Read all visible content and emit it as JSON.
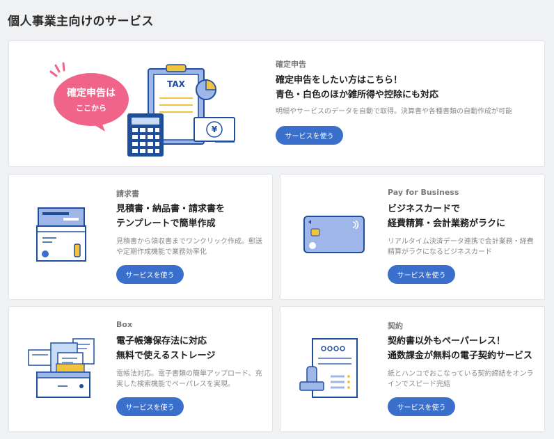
{
  "page": {
    "title": "個人事業主向けのサービス"
  },
  "featured": {
    "category": "確定申告",
    "headline_line1": "確定申告をしたい方はこちら！",
    "headline_line2": "青色・白色のほか雑所得や控除にも対応",
    "description": "明細やサービスのデータを自動で取得。決算書や各種書類の自動作成が可能",
    "button": "サービスを使う",
    "bubble_line1": "確定申告は",
    "bubble_line2": "ここから",
    "tax_label": "TAX",
    "yen_symbol": "¥"
  },
  "cards": [
    {
      "category": "請求書",
      "headline_line1": "見積書・納品書・請求書を",
      "headline_line2": "テンプレートで簡単作成",
      "desc_line1": "見積書から領収書までワンクリック作成。郵送",
      "desc_line2": "や定期作成機能で業務効率化",
      "button": "サービスを使う"
    },
    {
      "category": "Pay for Business",
      "headline_line1": "ビジネスカードで",
      "headline_line2": "経費精算・会計業務がラクに",
      "desc_line1": "リアルタイム決済データ連携で会計業務・経費",
      "desc_line2": "精算がラクになるビジネスカード",
      "button": "サービスを使う"
    },
    {
      "category": "Box",
      "headline_line1": "電子帳簿保存法に対応",
      "headline_line2": "無料で使えるストレージ",
      "desc_line1": "電帳法対応。電子書類の簡単アップロード、充",
      "desc_line2": "実した検索機能でペーパレスを実現。",
      "button": "サービスを使う"
    },
    {
      "category": "契約",
      "headline_line1": "契約書以外もペーパーレス！",
      "headline_line2": "通数課金が無料の電子契約サービス",
      "desc_line1": "紙とハンコでおこなっている契約締結をオンラ",
      "desc_line2": "インでスピード完結",
      "button": "サービスを使う"
    }
  ],
  "colors": {
    "accent": "#3a6fcb",
    "bubble": "#f0648a",
    "navy": "#1f4f9c",
    "yellow": "#f2c43d",
    "light_blue": "#c9dcf7"
  }
}
